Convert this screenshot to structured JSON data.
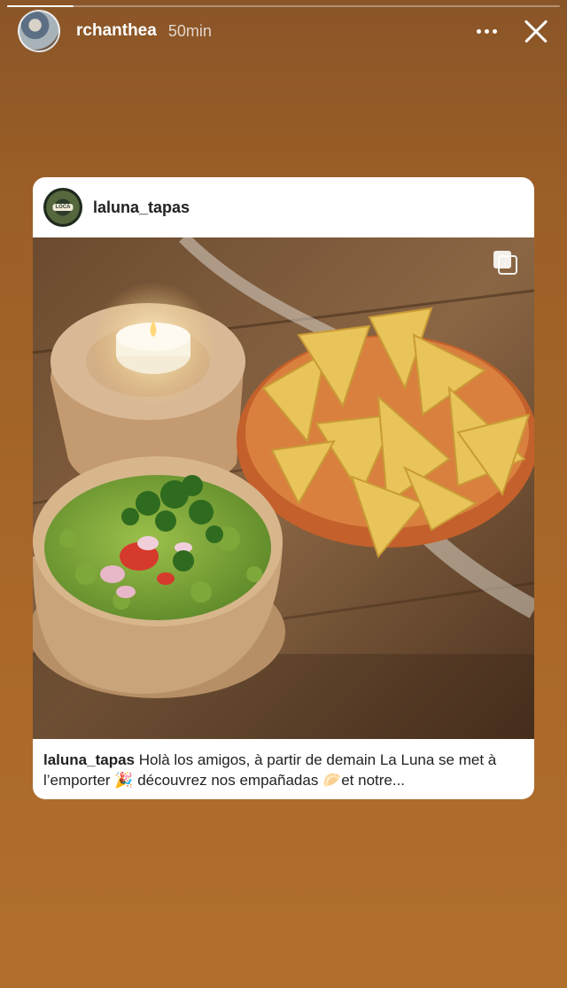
{
  "story": {
    "progress": 0.12,
    "username": "rchanthea",
    "time": "50min",
    "avatar_icon": "avatar-photo",
    "more_icon": "more-dots-icon",
    "close_icon": "close-icon"
  },
  "post": {
    "username": "laluna_tapas",
    "avatar_text": "LOCA",
    "caption_user": "laluna_tapas",
    "caption_text": " Holà los amigos, à partir de demain La Luna se met à l’emporter 🎉 découvrez nos empañadas 🥟et notre...",
    "multi_icon": "carousel-multiple-icon",
    "photo_alt": "guacamole bowl with tortilla chips and a candle on a wooden table"
  },
  "colors": {
    "background": "#a0622a",
    "card": "#ffffff"
  }
}
